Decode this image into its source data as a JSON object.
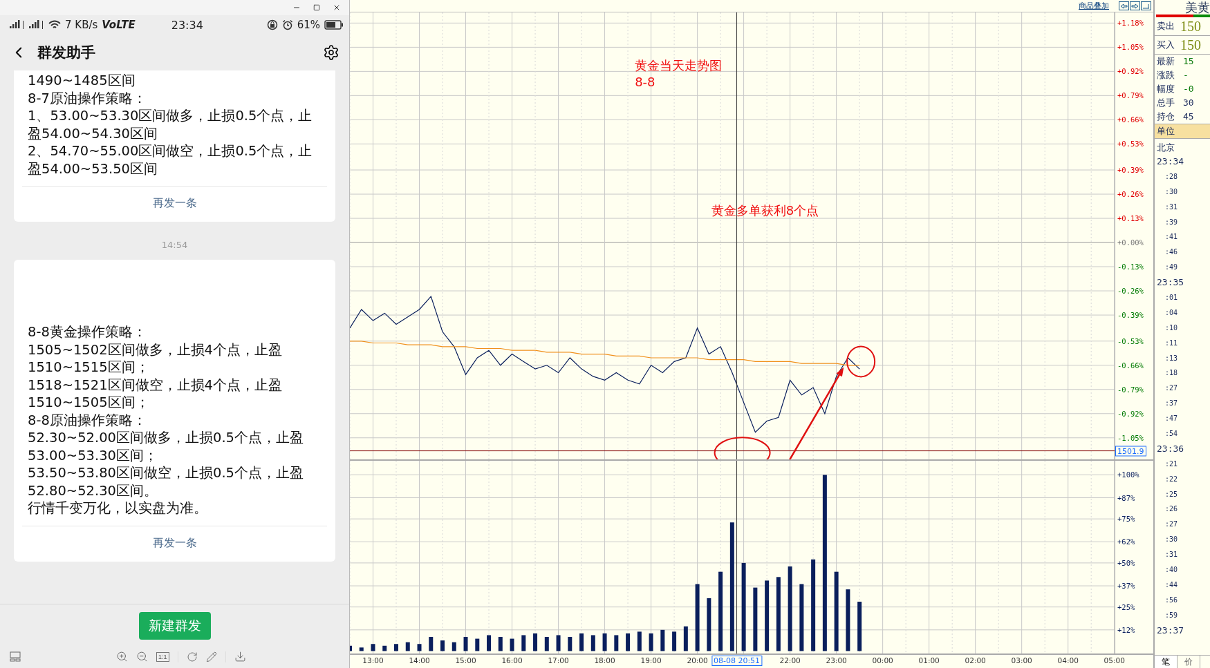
{
  "phone": {
    "status_bar": {
      "speed": "7 KB/s",
      "volte": "VoLTE",
      "time": "23:34",
      "battery": "61%"
    },
    "header": {
      "title": "群发助手"
    },
    "messages": [
      {
        "lines": [
          "1490~1485区间",
          "8-7原油操作策略：",
          "1、53.00~53.30区间做多，止损0.5个点，止",
          "盈54.00~54.30区间",
          "2、54.70~55.00区间做空，止损0.5个点，止",
          "盈54.00~53.50区间"
        ],
        "resend": "再发一条"
      },
      {
        "timestamp": "14:54",
        "lines": [
          "8-8黄金操作策略：",
          "1505~1502区间做多，止损4个点，止盈",
          "1510~1515区间；",
          "1518~1521区间做空，止损4个点，止盈",
          "1510~1505区间；",
          "8-8原油操作策略：",
          "52.30~52.00区间做多，止损0.5个点，止盈",
          "53.00~53.30区间；",
          "53.50~53.80区间做空，止损0.5个点，止盈",
          "52.80~52.30区间。",
          "行情千变万化，以实盘为准。"
        ],
        "resend": "再发一条"
      }
    ],
    "new_button": "新建群发",
    "toolbar_scale": "1:1"
  },
  "chart": {
    "overlay_link": "商品叠加",
    "cursor": {
      "price_label": "1501.9",
      "time_label": "08-08 20:51"
    },
    "price_pane": {
      "chart_data": {
        "type": "line",
        "xlim": [
          12.5,
          29.84
        ],
        "ylim": [
          -1.166,
          1.237
        ],
        "grid": true,
        "ref_lines": [
          {
            "axis": "y",
            "value": -1.12
          },
          {
            "axis": "x",
            "value": 20.85
          }
        ],
        "x": [
          12.5,
          12.75,
          13,
          13.25,
          13.5,
          13.75,
          14,
          14.25,
          14.5,
          14.75,
          15,
          15.25,
          15.5,
          15.75,
          16,
          16.25,
          16.5,
          16.75,
          17,
          17.25,
          17.5,
          17.75,
          18,
          18.25,
          18.5,
          18.75,
          19,
          19.25,
          19.5,
          19.75,
          20,
          20.25,
          20.5,
          20.75,
          21,
          21.25,
          21.5,
          21.75,
          22,
          22.25,
          22.5,
          22.75,
          23,
          23.25,
          23.5
        ],
        "series": [
          {
            "color": "#0a1f5c",
            "values": [
              -0.46,
              -0.36,
              -0.42,
              -0.38,
              -0.44,
              -0.4,
              -0.36,
              -0.29,
              -0.48,
              -0.56,
              -0.71,
              -0.62,
              -0.58,
              -0.66,
              -0.6,
              -0.64,
              -0.68,
              -0.66,
              -0.7,
              -0.62,
              -0.68,
              -0.72,
              -0.74,
              -0.7,
              -0.74,
              -0.76,
              -0.66,
              -0.7,
              -0.64,
              -0.62,
              -0.46,
              -0.6,
              -0.56,
              -0.7,
              -0.86,
              -1.02,
              -0.96,
              -0.94,
              -0.74,
              -0.82,
              -0.78,
              -0.92,
              -0.72,
              -0.62,
              -0.68
            ]
          },
          {
            "color": "#f0901c",
            "values": [
              -0.53,
              -0.53,
              -0.54,
              -0.54,
              -0.54,
              -0.55,
              -0.55,
              -0.55,
              -0.56,
              -0.56,
              -0.56,
              -0.57,
              -0.57,
              -0.57,
              -0.58,
              -0.58,
              -0.58,
              -0.59,
              -0.59,
              -0.59,
              -0.6,
              -0.6,
              -0.6,
              -0.61,
              -0.61,
              -0.61,
              -0.62,
              -0.62,
              -0.62,
              -0.62,
              -0.62,
              -0.63,
              -0.63,
              -0.63,
              -0.63,
              -0.64,
              -0.64,
              -0.64,
              -0.64,
              -0.65,
              -0.65,
              -0.65,
              -0.65,
              -0.66,
              -0.66
            ]
          }
        ],
        "yticks": [
          {
            "value": 1.18,
            "label": "+1.18%"
          },
          {
            "value": 1.05,
            "label": "+1.05%"
          },
          {
            "value": 0.92,
            "label": "+0.92%"
          },
          {
            "value": 0.79,
            "label": "+0.79%"
          },
          {
            "value": 0.66,
            "label": "+0.66%"
          },
          {
            "value": 0.53,
            "label": "+0.53%"
          },
          {
            "value": 0.39,
            "label": "+0.39%"
          },
          {
            "value": 0.26,
            "label": "+0.26%"
          },
          {
            "value": 0.13,
            "label": "+0.13%"
          },
          {
            "value": 0,
            "label": "+0.00%"
          },
          {
            "value": -0.13,
            "label": "-0.13%"
          },
          {
            "value": -0.26,
            "label": "-0.26%"
          },
          {
            "value": -0.39,
            "label": "-0.39%"
          },
          {
            "value": -0.53,
            "label": "-0.53%"
          },
          {
            "value": -0.66,
            "label": "-0.66%"
          },
          {
            "value": -0.79,
            "label": "-0.79%"
          },
          {
            "value": -0.92,
            "label": "-0.92%"
          },
          {
            "value": -1.05,
            "label": "-1.05%"
          }
        ],
        "annotations": [
          "黄金当天走势图",
          "8-8",
          "黄金多单获利8个点"
        ]
      }
    },
    "volume_pane": {
      "chart_data": {
        "type": "bar",
        "xlim": [
          12.5,
          29.84
        ],
        "ylim": [
          -0.014,
          1.08
        ],
        "grid": true,
        "ref_lines": [
          {
            "axis": "x",
            "value": 20.85
          }
        ],
        "x": [
          12.5,
          12.75,
          13,
          13.25,
          13.5,
          13.75,
          14,
          14.25,
          14.5,
          14.75,
          15,
          15.25,
          15.5,
          15.75,
          16,
          16.25,
          16.5,
          16.75,
          17,
          17.25,
          17.5,
          17.75,
          18,
          18.25,
          18.5,
          18.75,
          19,
          19.25,
          19.5,
          19.75,
          20,
          20.25,
          20.5,
          20.75,
          21,
          21.25,
          21.5,
          21.75,
          22,
          22.25,
          22.5,
          22.75,
          23,
          23.25,
          23.5
        ],
        "series": [
          {
            "color": "#0a1f5c",
            "values": [
              0.03,
              0.02,
              0.04,
              0.03,
              0.04,
              0.05,
              0.04,
              0.08,
              0.06,
              0.05,
              0.08,
              0.07,
              0.09,
              0.08,
              0.07,
              0.09,
              0.1,
              0.08,
              0.09,
              0.08,
              0.1,
              0.09,
              0.1,
              0.09,
              0.1,
              0.11,
              0.1,
              0.12,
              0.11,
              0.14,
              0.38,
              0.3,
              0.45,
              0.73,
              0.5,
              0.36,
              0.4,
              0.42,
              0.48,
              0.38,
              0.52,
              1.0,
              0.45,
              0.35,
              0.28
            ]
          }
        ],
        "yticks": [
          {
            "value": 1.0,
            "label": "+100%"
          },
          {
            "value": 0.87,
            "label": "+87%"
          },
          {
            "value": 0.75,
            "label": "+75%"
          },
          {
            "value": 0.62,
            "label": "+62%"
          },
          {
            "value": 0.5,
            "label": "+50%"
          },
          {
            "value": 0.37,
            "label": "+37%"
          },
          {
            "value": 0.25,
            "label": "+25%"
          },
          {
            "value": 0.12,
            "label": "+12%"
          }
        ],
        "xticks": [
          {
            "value": 13,
            "label": "13:00"
          },
          {
            "value": 14,
            "label": "14:00"
          },
          {
            "value": 15,
            "label": "15:00"
          },
          {
            "value": 16,
            "label": "16:00"
          },
          {
            "value": 17,
            "label": "17:00"
          },
          {
            "value": 18,
            "label": "18:00"
          },
          {
            "value": 19,
            "label": "19:00"
          },
          {
            "value": 20,
            "label": "20:00"
          },
          {
            "value": 22,
            "label": "22:00"
          },
          {
            "value": 23,
            "label": "23:00"
          },
          {
            "value": 24,
            "label": "00:00"
          }
        ]
      }
    },
    "later_time_labels": [
      "01:00",
      "02:00",
      "03:00",
      "04:00",
      "05:00"
    ]
  },
  "quote_panel": {
    "title": "美黄",
    "ratio": {
      "level": 0.69
    },
    "rows": [
      {
        "label": "卖出",
        "value": "150",
        "kind": "price"
      },
      {
        "label": "买入",
        "value": "150",
        "kind": "price"
      },
      {
        "label": "最新",
        "value": "15",
        "kind": "change"
      },
      {
        "label": "涨跌",
        "value": "-",
        "kind": "change"
      },
      {
        "label": "幅度",
        "value": "-0",
        "kind": "change"
      },
      {
        "label": "总手",
        "value": "30",
        "kind": "count"
      },
      {
        "label": "持仓",
        "value": "45",
        "kind": "count"
      }
    ],
    "unit": {
      "label": "单位"
    },
    "city": "北京",
    "ticks": [
      {
        "text": "23:34",
        "kind": "minute"
      },
      {
        "text": ":28",
        "kind": "second"
      },
      {
        "text": ":30",
        "kind": "second"
      },
      {
        "text": ":31",
        "kind": "second"
      },
      {
        "text": ":39",
        "kind": "second"
      },
      {
        "text": ":41",
        "kind": "second"
      },
      {
        "text": ":46",
        "kind": "second"
      },
      {
        "text": ":49",
        "kind": "second"
      },
      {
        "text": "23:35",
        "kind": "minute"
      },
      {
        "text": ":01",
        "kind": "second"
      },
      {
        "text": ":04",
        "kind": "second"
      },
      {
        "text": ":10",
        "kind": "second"
      },
      {
        "text": ":11",
        "kind": "second"
      },
      {
        "text": ":13",
        "kind": "second"
      },
      {
        "text": ":18",
        "kind": "second"
      },
      {
        "text": ":27",
        "kind": "second"
      },
      {
        "text": ":37",
        "kind": "second"
      },
      {
        "text": ":47",
        "kind": "second"
      },
      {
        "text": ":54",
        "kind": "second"
      },
      {
        "text": "23:36",
        "kind": "minute"
      },
      {
        "text": ":21",
        "kind": "second"
      },
      {
        "text": ":22",
        "kind": "second"
      },
      {
        "text": ":25",
        "kind": "second"
      },
      {
        "text": ":26",
        "kind": "second"
      },
      {
        "text": ":27",
        "kind": "second"
      },
      {
        "text": ":30",
        "kind": "second"
      },
      {
        "text": ":31",
        "kind": "second"
      },
      {
        "text": ":40",
        "kind": "second"
      },
      {
        "text": ":44",
        "kind": "second"
      },
      {
        "text": ":56",
        "kind": "second"
      },
      {
        "text": ":59",
        "kind": "second"
      },
      {
        "text": "23:37",
        "kind": "minute"
      }
    ],
    "tabs": [
      {
        "label": "笔",
        "selected": true
      },
      {
        "label": "价",
        "selected": false
      }
    ]
  }
}
